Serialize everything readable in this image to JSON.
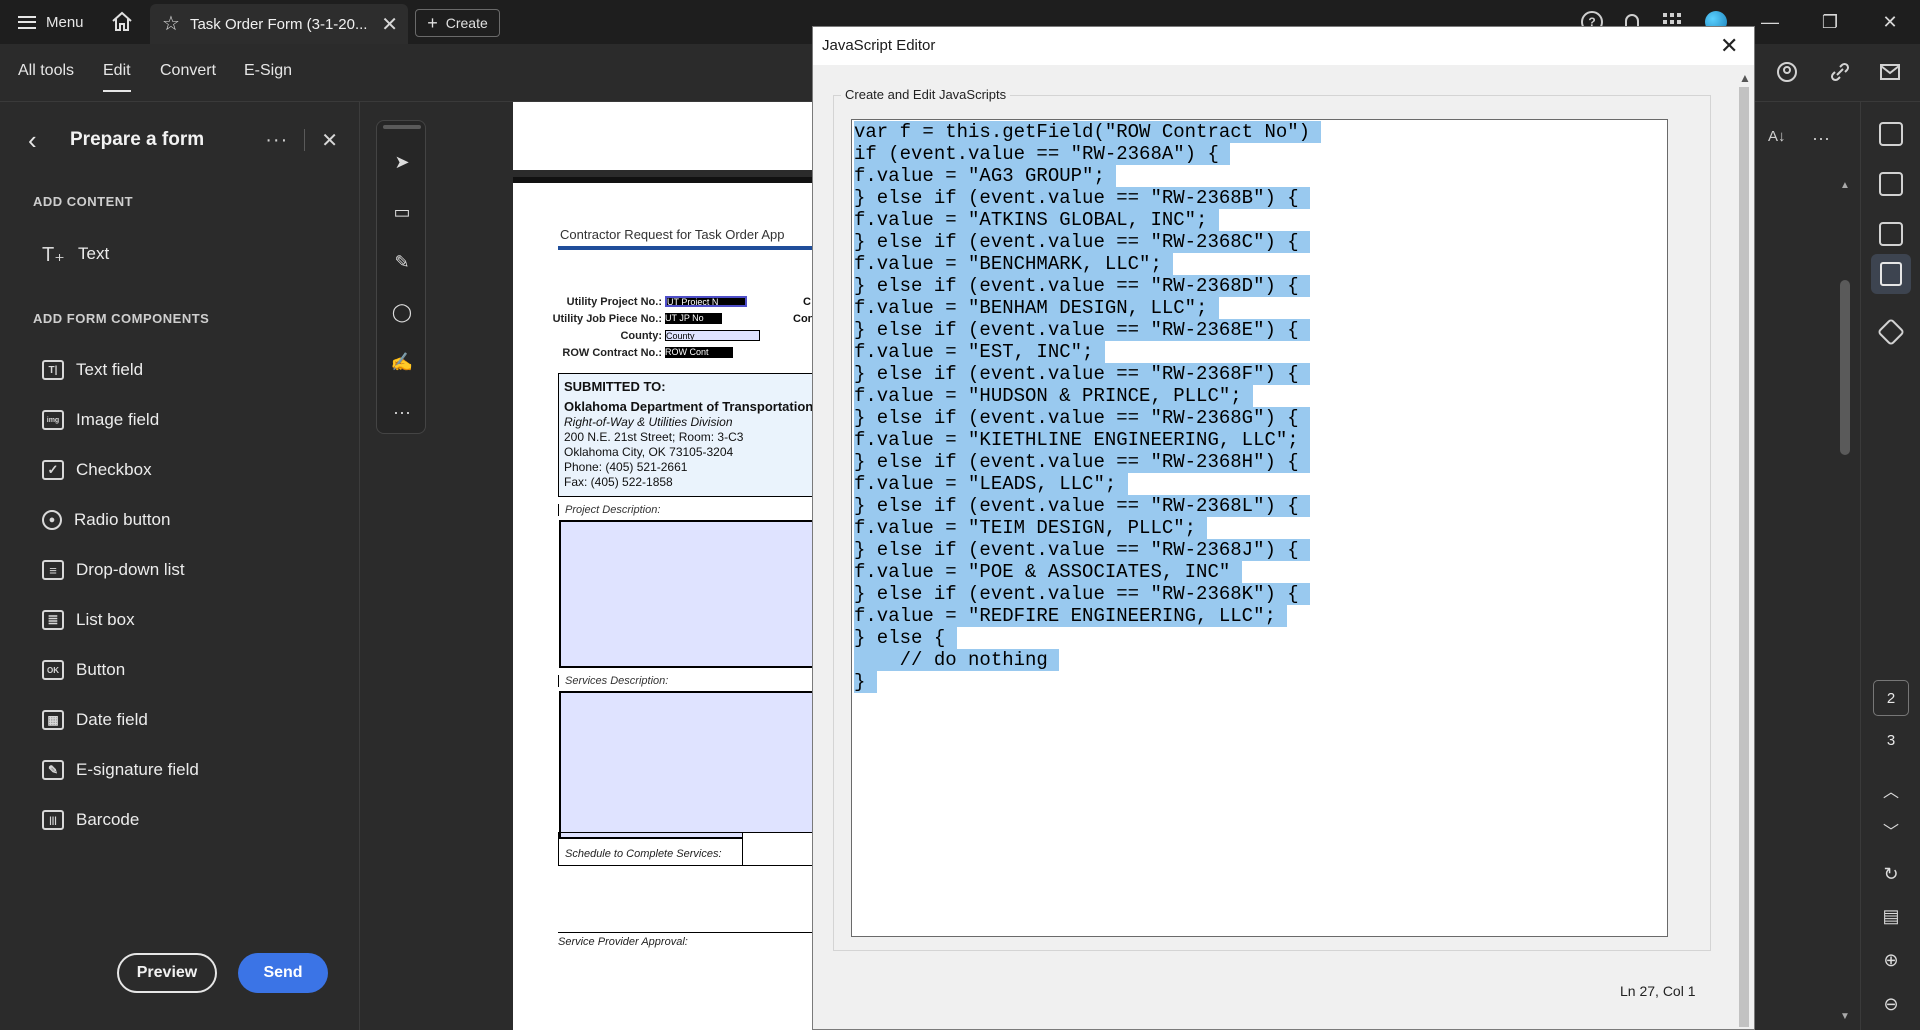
{
  "titlebar": {
    "menu_label": "Menu",
    "tab_title": "Task Order Form (3-1-20...",
    "create_label": "Create",
    "help_glyph": "?"
  },
  "toolbar": {
    "tabs": [
      "All tools",
      "Edit",
      "Convert",
      "E-Sign"
    ]
  },
  "left_panel": {
    "title": "Prepare a form",
    "section_add_content": "ADD CONTENT",
    "text_item": "Text",
    "section_form_components": "ADD FORM COMPONENTS",
    "components": [
      {
        "label": "Text field",
        "icon": "T|"
      },
      {
        "label": "Image field",
        "icon": "img"
      },
      {
        "label": "Checkbox",
        "icon": "✓"
      },
      {
        "label": "Radio button",
        "icon": "●"
      },
      {
        "label": "Drop-down list",
        "icon": "≡"
      },
      {
        "label": "List box",
        "icon": "≣"
      },
      {
        "label": "Button",
        "icon": "OK"
      },
      {
        "label": "Date field",
        "icon": "▦"
      },
      {
        "label": "E-signature field",
        "icon": "✎"
      },
      {
        "label": "Barcode",
        "icon": "|||"
      }
    ],
    "preview_label": "Preview",
    "send_label": "Send"
  },
  "document": {
    "header_text": "Contractor Request for Task Order App",
    "fields": [
      {
        "label": "Utility Project No.:",
        "value": "UT Project N"
      },
      {
        "label": "Utility Job Piece No.:",
        "value": "UT JP No"
      },
      {
        "label": "County:",
        "value": "County"
      },
      {
        "label": "ROW Contract No.:",
        "value": "ROW Cont"
      }
    ],
    "right_col_fragments": [
      "C",
      "Con"
    ],
    "submitted_to": "SUBMITTED TO:",
    "org_name": "Oklahoma Department of Transportation",
    "division": "Right-of-Way & Utilities Division",
    "address1": "200 N.E. 21st Street; Room: 3-C3",
    "address2": "Oklahoma City, OK  73105-3204",
    "phone": "Phone: (405) 521-2661",
    "fax": "Fax: (405) 522-1858",
    "project_description_label": "Project Description:",
    "services_description_label": "Services Description:",
    "schedule_label": "Schedule to Complete Services:",
    "approval_label": "Service Provider Approval:"
  },
  "right_rail": {
    "pages": [
      "2",
      "3"
    ]
  },
  "js_editor": {
    "title": "JavaScript Editor",
    "group_label": "Create and Edit JavaScripts",
    "status": "Ln 27, Col 1",
    "code_lines": [
      "var f = this.getField(\"ROW Contract No\")",
      "if (event.value == \"RW-2368A\") {",
      "f.value = \"AG3 GROUP\";",
      "} else if (event.value == \"RW-2368B\") {",
      "f.value = \"ATKINS GLOBAL, INC\";",
      "} else if (event.value == \"RW-2368C\") {",
      "f.value = \"BENCHMARK, LLC\";",
      "} else if (event.value == \"RW-2368D\") {",
      "f.value = \"BENHAM DESIGN, LLC\";",
      "} else if (event.value == \"RW-2368E\") {",
      "f.value = \"EST, INC\";",
      "} else if (event.value == \"RW-2368F\") {",
      "f.value = \"HUDSON & PRINCE, PLLC\";",
      "} else if (event.value == \"RW-2368G\") {",
      "f.value = \"KIETHLINE ENGINEERING, LLC\";",
      "} else if (event.value == \"RW-2368H\") {",
      "f.value = \"LEADS, LLC\";",
      "} else if (event.value == \"RW-2368L\") {",
      "f.value = \"TEIM DESIGN, PLLC\";",
      "} else if (event.value == \"RW-2368J\") {",
      "f.value = \"POE & ASSOCIATES, INC\"",
      "} else if (event.value == \"RW-2368K\") {",
      "f.value = \"REDFIRE ENGINEERING, LLC\";",
      "} else {",
      "    // do nothing",
      "}"
    ]
  },
  "colors": {
    "accent": "#3b74e6",
    "selection": "#99c9ef",
    "form_field_fill": "#dfe3ff"
  }
}
